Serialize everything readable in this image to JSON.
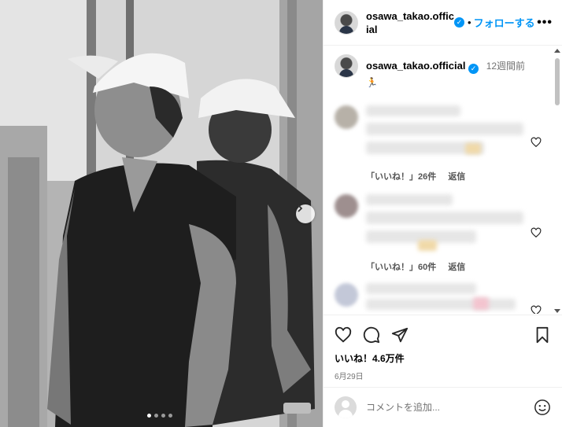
{
  "post": {
    "username": "osawa_takao.official",
    "follow_label": "フォローする",
    "separator": "•",
    "more_label": "•••"
  },
  "caption": {
    "username": "osawa_takao.official",
    "time_ago": "12週間前",
    "text": "🏃"
  },
  "comments": [
    {
      "likes_label": "「いいね！」26件",
      "reply_label": "返信"
    },
    {
      "likes_label": "「いいね！」60件",
      "reply_label": "返信"
    },
    {
      "likes_label": "",
      "reply_label": ""
    }
  ],
  "actions": {
    "likes_total": "いいね！4.6万件",
    "date": "6月29日"
  },
  "add_comment": {
    "placeholder": "コメントを追加..."
  },
  "carousel": {
    "current_index": 1,
    "total": 4
  },
  "colors": {
    "accent": "#0095f6",
    "muted": "#737373"
  }
}
